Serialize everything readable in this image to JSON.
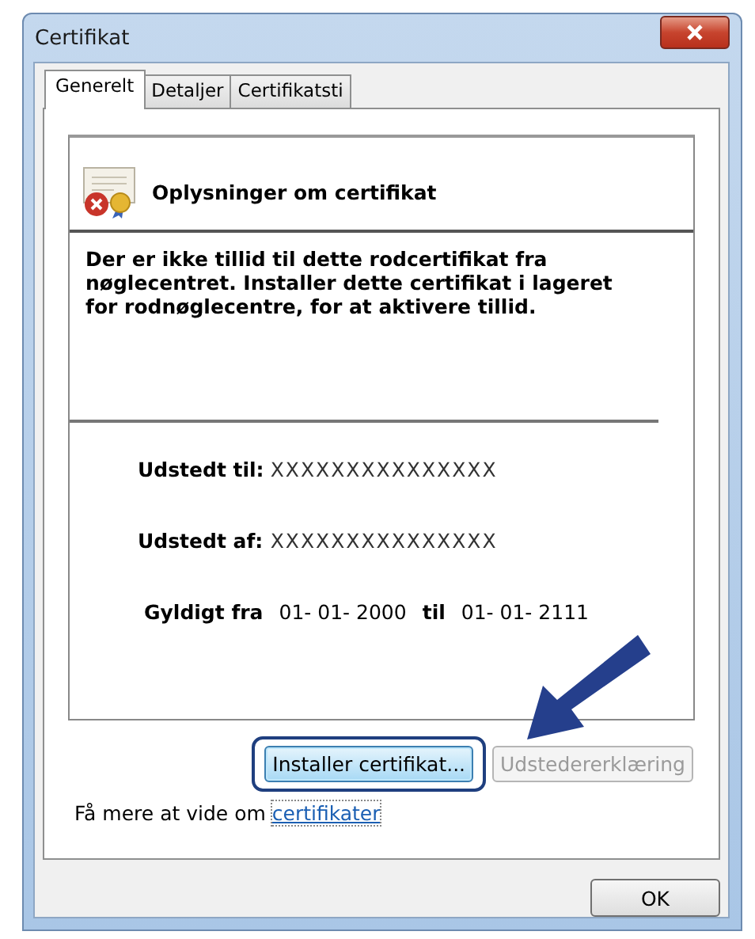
{
  "window": {
    "title": "Certifikat"
  },
  "tabs": [
    {
      "label": "Generelt",
      "selected": true
    },
    {
      "label": "Detaljer",
      "selected": false
    },
    {
      "label": "Certifikatsti",
      "selected": false
    }
  ],
  "certificate": {
    "heading": "Oplysninger om certifikat",
    "message": "Der er ikke tillid til dette rodcertifikat fra nøglecentret. Installer dette certifikat i lageret for rodnøglecentre, for at aktivere tillid.",
    "fields": [
      {
        "label": "Udstedt til:",
        "value": "XXXXXXXXXXXXXXX"
      },
      {
        "label": "Udstedt af:",
        "value": "XXXXXXXXXXXXXXX"
      }
    ],
    "validity": {
      "from_label": "Gyldigt fra",
      "from": "01- 01- 2000",
      "to_label": "til",
      "to": "01- 01- 2111"
    }
  },
  "buttons": [
    {
      "label": "Installer certifikat...",
      "disabled": false,
      "highlighted": true
    },
    {
      "label": "Udstedererklæring",
      "disabled": true,
      "highlighted": false
    }
  ],
  "learn_more": {
    "text": "Få mere at vide om",
    "link": "certifikater"
  },
  "ok_button": {
    "label": "OK"
  }
}
